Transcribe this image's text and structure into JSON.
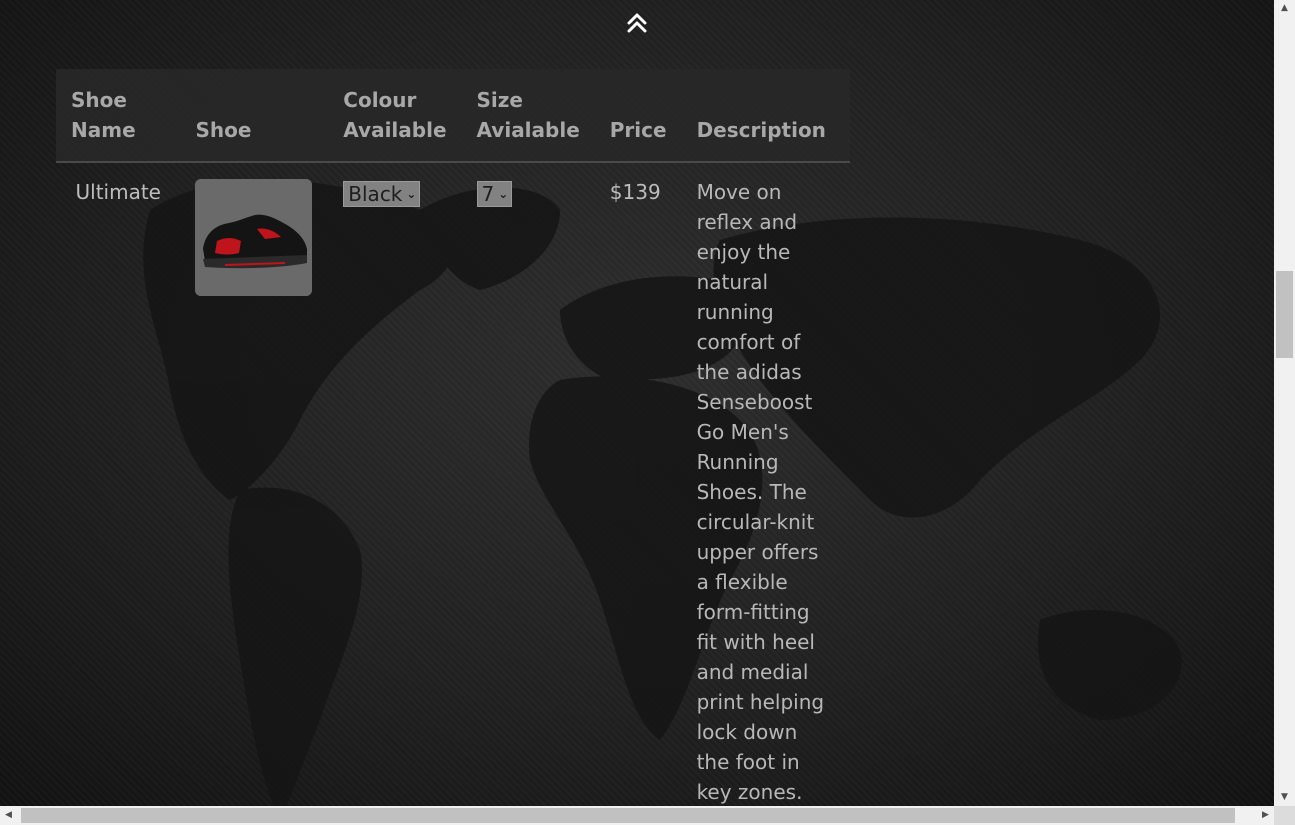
{
  "nav": {
    "scroll_top_icon": "double-chevron-up-icon"
  },
  "table": {
    "headers": {
      "shoe_name": "Shoe Name",
      "shoe": "Shoe",
      "colour": "Colour Available",
      "size": "Size Avialable",
      "price": "Price",
      "description": "Description"
    },
    "rows": [
      {
        "name": "Ultimate",
        "image_icon": "black-red-sneaker-image",
        "colour_selected": "Black",
        "size_selected": "7",
        "price": "$139",
        "description": "Move on reflex and enjoy the natural running comfort of the adidas Senseboost Go Men's Running Shoes. The circular-knit upper offers a flexible form-fitting fit with heel and medial print helping lock down the foot in key zones. Extra space"
      }
    ]
  },
  "colors": {
    "background": "#1b1b1b",
    "header_bg": "#282828",
    "text": "#bdbdbd",
    "select_bg": "#828282",
    "accent_red": "#c0141c"
  }
}
